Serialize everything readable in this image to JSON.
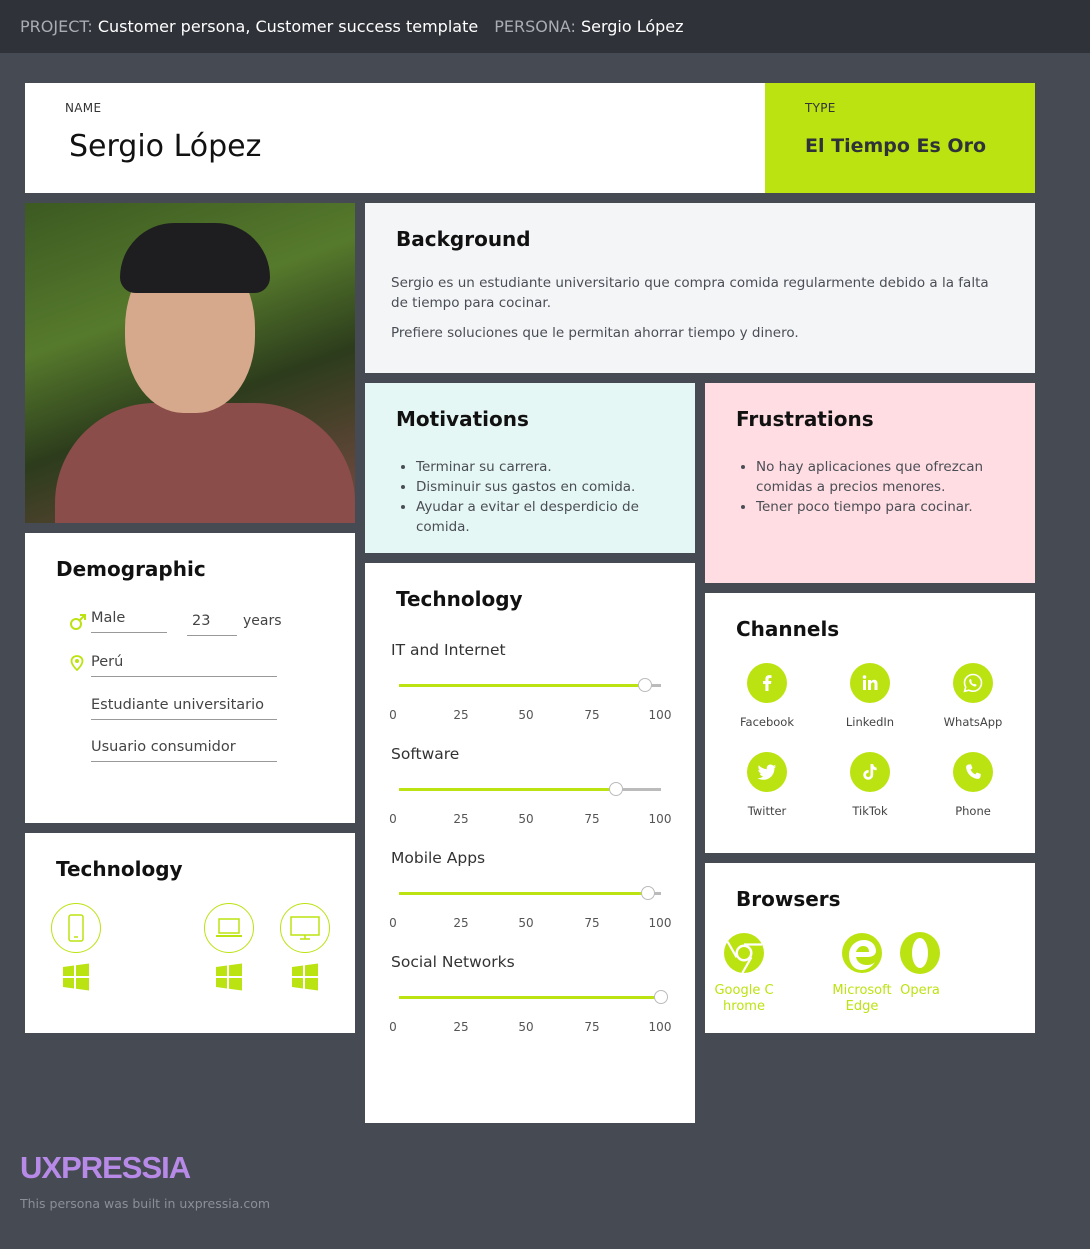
{
  "header": {
    "project_label": "PROJECT:",
    "project_value": "Customer persona, Customer success template",
    "persona_label": "PERSONA:",
    "persona_value": "Sergio López"
  },
  "name": {
    "label": "NAME",
    "value": "Sergio López"
  },
  "type": {
    "label": "TYPE",
    "value": "El Tiempo Es Oro"
  },
  "background": {
    "title": "Background",
    "paragraphs": [
      "Sergio es un estudiante universitario que compra comida regularmente debido a la falta de tiempo para cocinar.",
      "Prefiere soluciones que le permitan ahorrar tiempo y dinero."
    ]
  },
  "motivations": {
    "title": "Motivations",
    "items": [
      "Terminar su carrera.",
      "Disminuir sus gastos en comida.",
      "Ayudar a evitar el desperdicio de comida."
    ]
  },
  "frustrations": {
    "title": "Frustrations",
    "items": [
      "No hay aplicaciones que ofrezcan comidas a precios menores.",
      "Tener poco tiempo para cocinar."
    ]
  },
  "demographic": {
    "title": "Demographic",
    "gender": "Male",
    "age": "23",
    "age_unit": "years",
    "location": "Perú",
    "occupation": "Estudiante universitario",
    "role": "Usuario consumidor"
  },
  "technology_devices": {
    "title": "Technology",
    "devices": [
      {
        "icon": "smartphone-icon",
        "os": "windows-icon"
      },
      {
        "icon": "laptop-icon",
        "os": "windows-icon"
      },
      {
        "icon": "desktop-icon",
        "os": "windows-icon"
      }
    ]
  },
  "technology_skills": {
    "title": "Technology",
    "ticks": [
      "0",
      "25",
      "50",
      "75",
      "100"
    ],
    "sliders": [
      {
        "label": "IT and Internet",
        "value": 94
      },
      {
        "label": "Software",
        "value": 83
      },
      {
        "label": "Mobile Apps",
        "value": 95
      },
      {
        "label": "Social Networks",
        "value": 100
      }
    ]
  },
  "channels": {
    "title": "Channels",
    "items": [
      {
        "name": "Facebook",
        "icon": "facebook-icon"
      },
      {
        "name": "LinkedIn",
        "icon": "linkedin-icon"
      },
      {
        "name": "WhatsApp",
        "icon": "whatsapp-icon"
      },
      {
        "name": "Twitter",
        "icon": "twitter-icon"
      },
      {
        "name": "TikTok",
        "icon": "tiktok-icon"
      },
      {
        "name": "Phone",
        "icon": "phone-icon"
      }
    ]
  },
  "browsers": {
    "title": "Browsers",
    "items": [
      {
        "name": "Google Chrome",
        "icon": "chrome-icon"
      },
      {
        "name": "Microsoft Edge",
        "icon": "edge-icon"
      },
      {
        "name": "Opera",
        "icon": "opera-icon"
      }
    ]
  },
  "footer": {
    "brand": "UXPRESSIA",
    "note": "This persona was built in uxpressia.com"
  },
  "colors": {
    "accent": "#bbe311",
    "brand": "#b78ae8",
    "background": "#464a52",
    "topbar": "#2f3239"
  }
}
